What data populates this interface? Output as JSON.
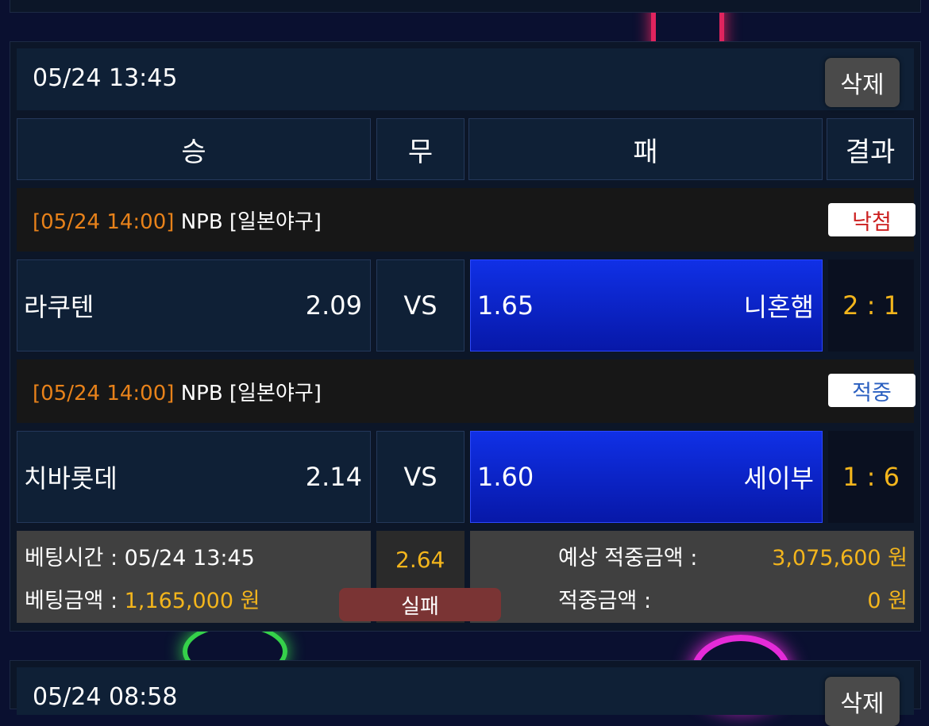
{
  "bets": [
    {
      "datetime": "05/24 13:45",
      "delete_label": "삭제",
      "columns": {
        "win": "승",
        "draw": "무",
        "loss": "패",
        "result": "결과"
      },
      "games": [
        {
          "date": "[05/24 14:00]",
          "league": "NPB [일본야구]",
          "status": "낙첨",
          "status_color": "#cc1f1f",
          "home_team": "라쿠텐",
          "home_odds": "2.09",
          "vs": "VS",
          "away_odds": "1.65",
          "away_team": "니혼햄",
          "score": "2 : 1"
        },
        {
          "date": "[05/24 14:00]",
          "league": "NPB [일본야구]",
          "status": "적중",
          "status_color": "#2a5fc0",
          "home_team": "치바롯데",
          "home_odds": "2.14",
          "vs": "VS",
          "away_odds": "1.60",
          "away_team": "세이부",
          "score": "1 : 6"
        }
      ],
      "footer": {
        "bet_time_label": "베팅시간 : 05/24 13:45",
        "bet_amount_label": "베팅금액 : ",
        "bet_amount_value": "1,165,000 원",
        "total_odds": "2.64",
        "result_label": "실패",
        "expected_label": "예상 적중금액 :",
        "expected_value": "3,075,600 원",
        "win_label": "적중금액 :",
        "win_value": "0 원"
      }
    },
    {
      "datetime": "05/24 08:58",
      "delete_label": "삭제"
    }
  ],
  "colors": {
    "background": "#0a1030",
    "date_orange": "#e8821a",
    "amount_yellow": "#f3b51c",
    "selected_blue": "#1030e6",
    "fail_red": "#7a3434"
  }
}
